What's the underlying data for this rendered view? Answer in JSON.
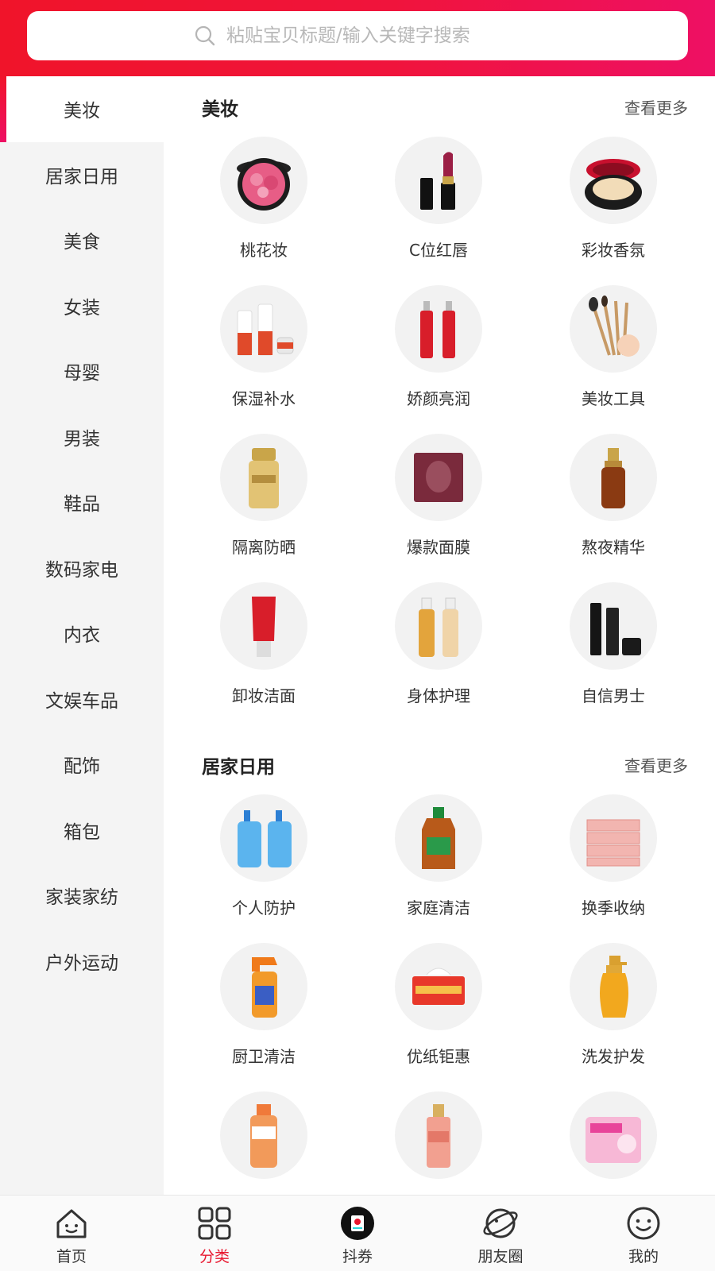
{
  "search": {
    "placeholder": "粘贴宝贝标题/输入关键字搜索"
  },
  "sidebar": {
    "items": [
      {
        "label": "美妆",
        "active": true
      },
      {
        "label": "居家日用"
      },
      {
        "label": "美食"
      },
      {
        "label": "女装"
      },
      {
        "label": "母婴"
      },
      {
        "label": "男装"
      },
      {
        "label": "鞋品"
      },
      {
        "label": "数码家电"
      },
      {
        "label": "内衣"
      },
      {
        "label": "文娱车品"
      },
      {
        "label": "配饰"
      },
      {
        "label": "箱包"
      },
      {
        "label": "家装家纺"
      },
      {
        "label": "户外运动"
      }
    ]
  },
  "sections": [
    {
      "title": "美妆",
      "more": "查看更多",
      "items": [
        {
          "label": "桃花妆",
          "icon": "blush-compact-icon"
        },
        {
          "label": "C位红唇",
          "icon": "lipstick-icon"
        },
        {
          "label": "彩妆香氛",
          "icon": "cushion-compact-icon"
        },
        {
          "label": "保湿补水",
          "icon": "skincare-set-icon"
        },
        {
          "label": "娇颜亮润",
          "icon": "toner-bottles-icon"
        },
        {
          "label": "美妆工具",
          "icon": "makeup-brushes-icon"
        },
        {
          "label": "隔离防晒",
          "icon": "sunscreen-icon"
        },
        {
          "label": "爆款面膜",
          "icon": "face-mask-icon"
        },
        {
          "label": "熬夜精华",
          "icon": "serum-bottle-icon"
        },
        {
          "label": "卸妆洁面",
          "icon": "cleanser-tube-icon"
        },
        {
          "label": "身体护理",
          "icon": "body-care-bottles-icon"
        },
        {
          "label": "自信男士",
          "icon": "men-skincare-icon"
        }
      ]
    },
    {
      "title": "居家日用",
      "more": "查看更多",
      "items": [
        {
          "label": "个人防护",
          "icon": "hand-soap-icon"
        },
        {
          "label": "家庭清洁",
          "icon": "disinfectant-icon"
        },
        {
          "label": "换季收纳",
          "icon": "storage-drawers-icon"
        },
        {
          "label": "厨卫清洁",
          "icon": "spray-cleaner-icon"
        },
        {
          "label": "优纸钜惠",
          "icon": "tissue-box-icon"
        },
        {
          "label": "洗发护发",
          "icon": "shampoo-icon"
        },
        {
          "label": "",
          "icon": "mouthwash-icon"
        },
        {
          "label": "",
          "icon": "perfume-mist-icon"
        },
        {
          "label": "",
          "icon": "sanitary-pad-icon"
        }
      ]
    }
  ],
  "bottom_nav": [
    {
      "label": "首页",
      "icon": "home-icon"
    },
    {
      "label": "分类",
      "icon": "grid-icon",
      "active": true
    },
    {
      "label": "抖券",
      "icon": "coupon-icon"
    },
    {
      "label": "朋友圈",
      "icon": "planet-icon"
    },
    {
      "label": "我的",
      "icon": "smiley-icon"
    }
  ],
  "colors": {
    "accent": "#e8162e",
    "header_start": "#f0142a",
    "header_end": "#ee1064"
  }
}
